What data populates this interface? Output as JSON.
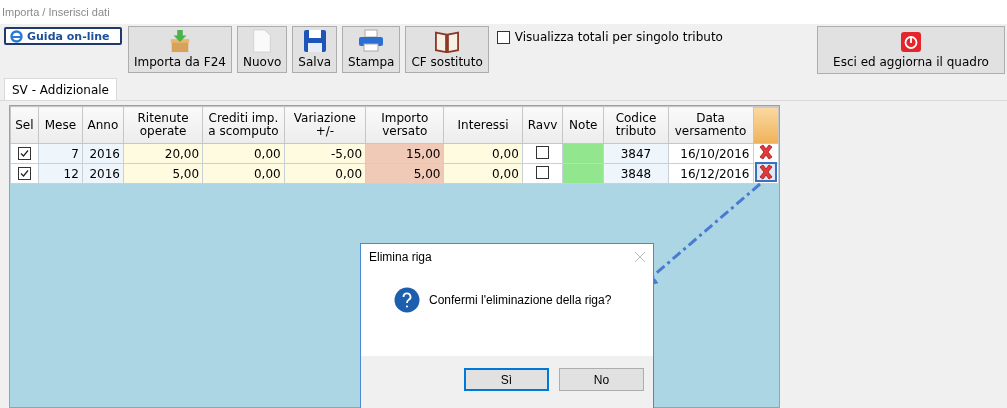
{
  "window": {
    "title": "Importa / Inserisci dati"
  },
  "help_button": {
    "label": "Guida on-line"
  },
  "toolbar": [
    {
      "label": "Importa da F24",
      "kind": "import"
    },
    {
      "label": "Nuovo",
      "kind": "new"
    },
    {
      "label": "Salva",
      "kind": "save"
    },
    {
      "label": "Stampa",
      "kind": "print"
    },
    {
      "label": "CF sostituto",
      "kind": "book"
    }
  ],
  "totals_checkbox": {
    "label": "Visualizza totali per singolo tributo",
    "checked": false
  },
  "exit_button": {
    "label": "Esci ed aggiorna il quadro"
  },
  "tabs": [
    {
      "label": "SV - Addizionale",
      "selected": true
    }
  ],
  "table": {
    "columns": [
      "Sel",
      "Mese",
      "Anno",
      "Ritenute operate",
      "Crediti imp. a scomputo",
      "Variazione +/-",
      "Importo versato",
      "Interessi",
      "Ravv",
      "Note",
      "Codice tributo",
      "Data versamento"
    ],
    "rows": [
      {
        "sel": true,
        "mese": "7",
        "anno": "2016",
        "ritenute": "20,00",
        "crediti": "0,00",
        "variazione": "-5,00",
        "importo": "15,00",
        "interessi": "0,00",
        "ravv": false,
        "codice": "3847",
        "data": "16/10/2016",
        "selected": false
      },
      {
        "sel": true,
        "mese": "12",
        "anno": "2016",
        "ritenute": "5,00",
        "crediti": "0,00",
        "variazione": "0,00",
        "importo": "5,00",
        "interessi": "0,00",
        "ravv": false,
        "codice": "3848",
        "data": "16/12/2016",
        "selected": true
      }
    ]
  },
  "dialog": {
    "title": "Elimina riga",
    "message": "Confermi l'eliminazione della riga?",
    "buttons": [
      {
        "label": "Sì",
        "default": true
      },
      {
        "label": "No",
        "default": false
      }
    ]
  }
}
